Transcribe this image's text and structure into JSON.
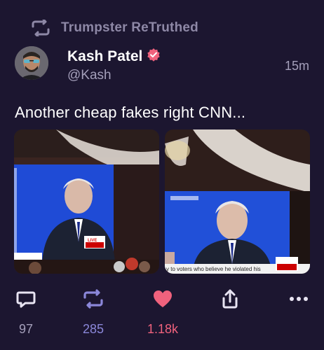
{
  "retruth": {
    "label": "Trumpster ReTruthed",
    "icon": "retruth-icon"
  },
  "author": {
    "name": "Kash Patel",
    "handle": "@Kash",
    "verified": true,
    "verified_color": "#f0627d"
  },
  "post": {
    "time": "15m",
    "text": "Another cheap fakes right CNN...",
    "media": [
      {
        "label_badge": "LIVE",
        "network": "CNN",
        "chyron": "RESIDENT"
      },
      {
        "label_badge": "LIVE",
        "network": "CNN",
        "chyron": "y to voters who believe he violated his"
      }
    ]
  },
  "actions": {
    "reply": {
      "icon": "comment-icon",
      "count": "97"
    },
    "retruth": {
      "icon": "retruth-icon",
      "count": "285"
    },
    "like": {
      "icon": "heart-icon",
      "count": "1.18k",
      "active": true
    },
    "share": {
      "icon": "share-icon"
    },
    "more": {
      "icon": "more-icon"
    }
  },
  "colors": {
    "background": "#1c1630",
    "muted": "#a49fba",
    "retruth_accent": "#8b87d9",
    "like_accent": "#f0627d"
  }
}
